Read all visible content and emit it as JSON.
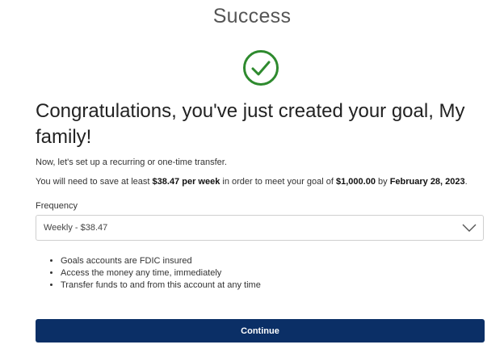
{
  "header": {
    "title": "Success"
  },
  "icons": {
    "success": "check-circle-icon",
    "dropdown": "chevron-down-icon"
  },
  "colors": {
    "success_green": "#2e8a2e",
    "primary_button": "#0b2f66"
  },
  "main": {
    "headline": "Congratulations, you've just created your goal, My family!",
    "instruction": "Now, let's set up a recurring or one-time transfer.",
    "savings_message": {
      "prefix": "You will need to save at least ",
      "amount_per_period": "$38.47 per week",
      "middle": " in order to meet your goal of ",
      "goal_amount": "$1,000.00",
      "by_text": " by ",
      "goal_date": "February 28, 2023",
      "suffix": "."
    },
    "frequency": {
      "label": "Frequency",
      "selected_value": "Weekly - $38.47"
    },
    "benefits": [
      "Goals accounts are FDIC insured",
      "Access the money any time, immediately",
      "Transfer funds to and from this account at any time"
    ],
    "continue_label": "Continue"
  }
}
